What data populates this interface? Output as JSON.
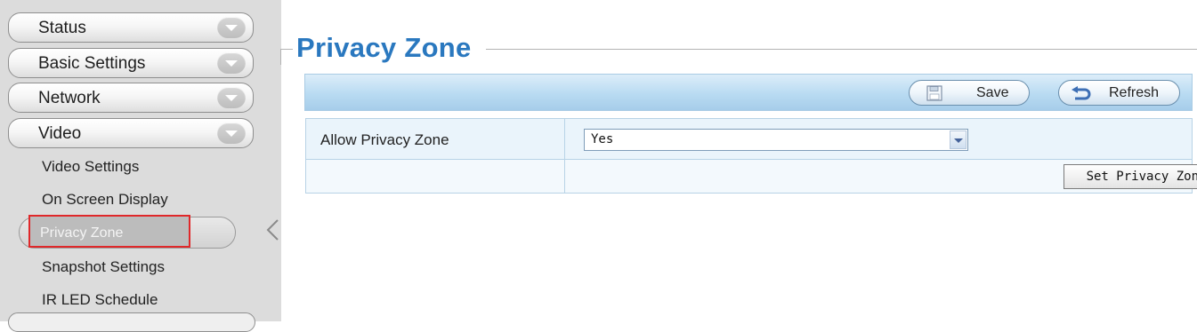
{
  "sidebar": {
    "sections": [
      {
        "label": "Status"
      },
      {
        "label": "Basic Settings"
      },
      {
        "label": "Network"
      },
      {
        "label": "Video"
      }
    ],
    "video_items": [
      {
        "label": "Video Settings"
      },
      {
        "label": "On Screen Display"
      },
      {
        "label": "Privacy Zone"
      },
      {
        "label": "Snapshot Settings"
      },
      {
        "label": "IR LED Schedule"
      }
    ],
    "selected_item": "Privacy Zone"
  },
  "page": {
    "title": "Privacy Zone"
  },
  "toolbar": {
    "save_label": "Save",
    "refresh_label": "Refresh"
  },
  "form": {
    "allow_label": "Allow Privacy Zone",
    "allow_value": "Yes",
    "set_button_label": "Set Privacy Zone"
  },
  "colors": {
    "title": "#2a78bf",
    "toolbar": "#b9dbf2",
    "highlight": "#e0282a",
    "sidebar_bg": "#dcdcdc"
  },
  "icons": {
    "menu_chevron": "chevron-down-icon",
    "save": "save-icon",
    "refresh": "refresh-icon",
    "collapse": "collapse-arrow-icon",
    "select": "dropdown-arrow-icon"
  }
}
